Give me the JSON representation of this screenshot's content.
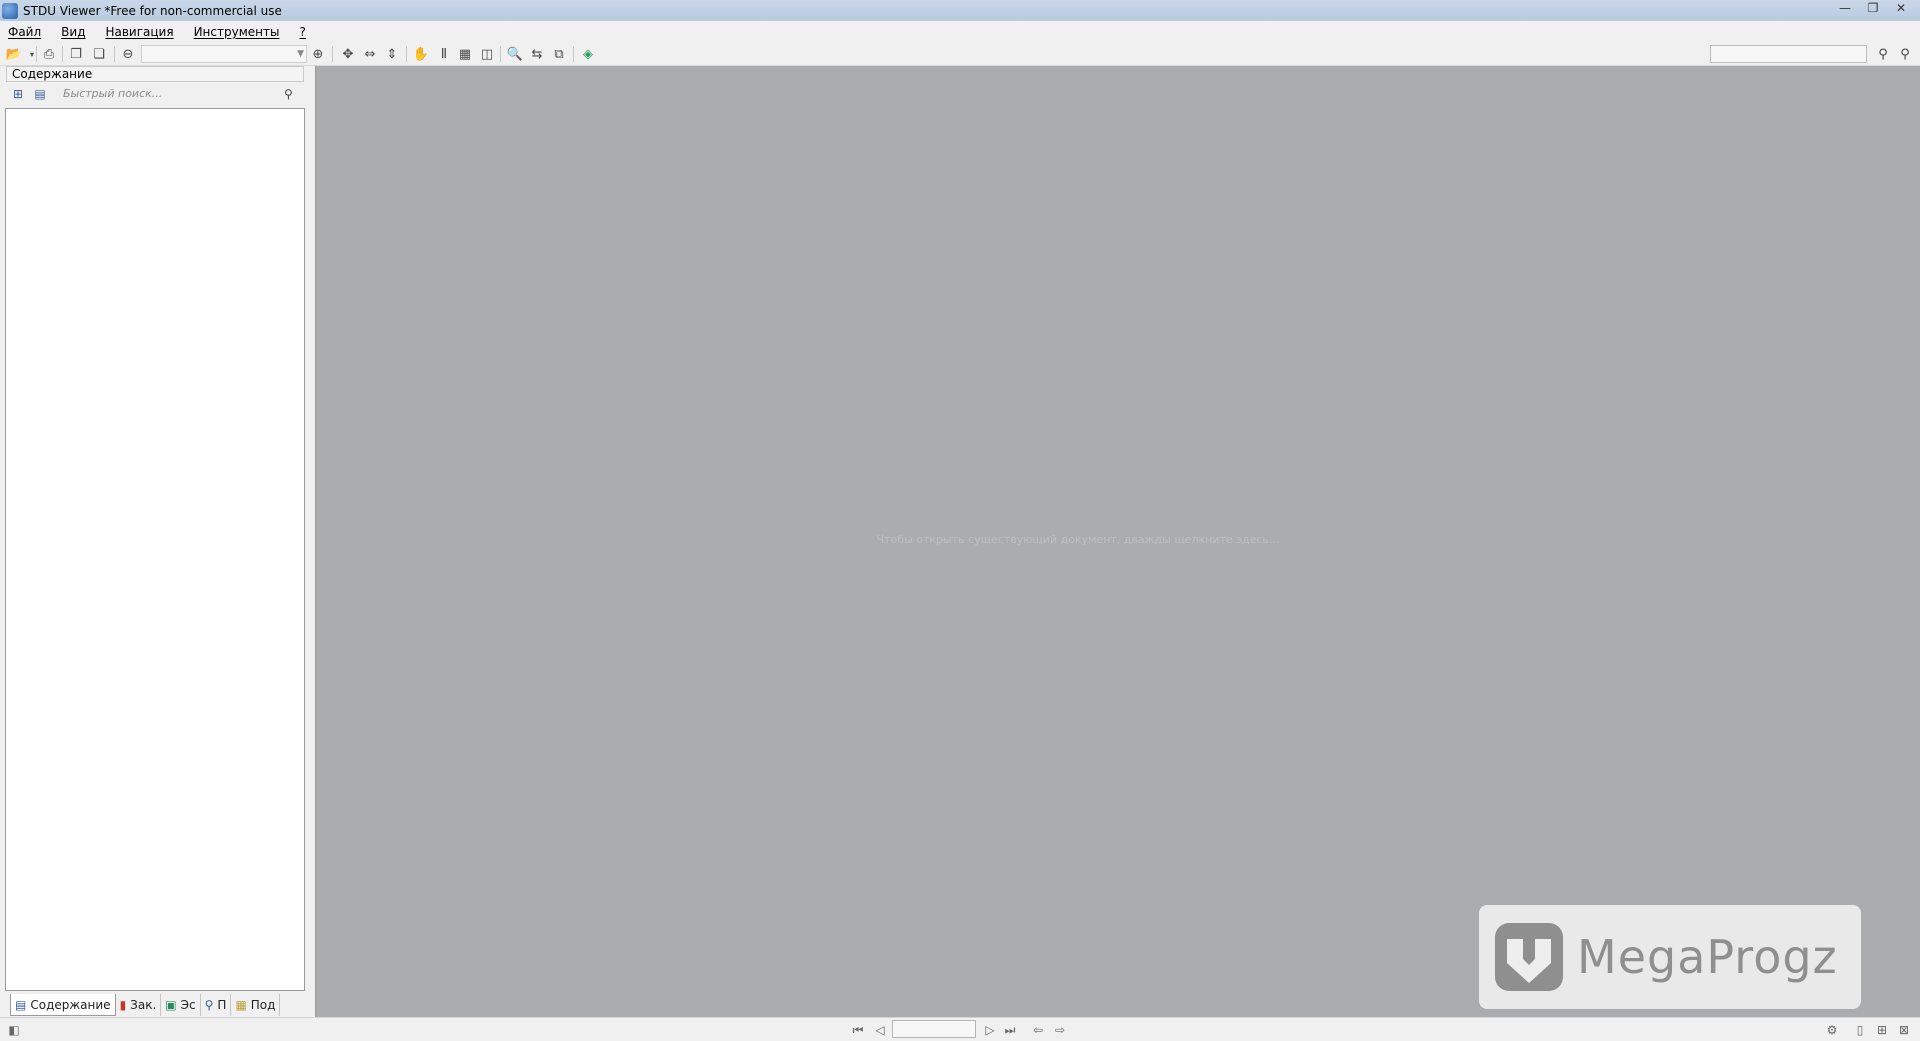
{
  "window": {
    "title": "STDU Viewer *Free for non-commercial use",
    "ghost_tab_1": "",
    "ghost_tab_2": "",
    "controls": [
      "—",
      "❐",
      "✕"
    ]
  },
  "menu": {
    "items": [
      "Файл",
      "Вид",
      "Навигация",
      "Инструменты",
      "?"
    ]
  },
  "toolbar": {
    "icons": [
      "open-icon",
      "print-icon",
      "copy-page-icon",
      "export-icon",
      "zoom-out-icon",
      "zoom-in-icon",
      "fit-page-icon",
      "fit-width-icon",
      "fit-height-icon",
      "hand-tool-icon",
      "select-text-icon",
      "select-image-icon",
      "snapshot-icon",
      "find-icon",
      "rotate-icon",
      "copy-icon",
      "update-icon",
      "find-next-icon",
      "find-prev-icon"
    ]
  },
  "left_panel": {
    "header": "Содержание",
    "quick_search_placeholder": "Быстрый поиск...",
    "tabs": [
      "Содержание",
      "Зак.",
      "Эс",
      "П",
      "Под"
    ]
  },
  "main": {
    "hint": "Чтобы открыть существующий документ, дважды щелкните здесь..."
  },
  "watermark": {
    "text": "MegaProgz"
  }
}
